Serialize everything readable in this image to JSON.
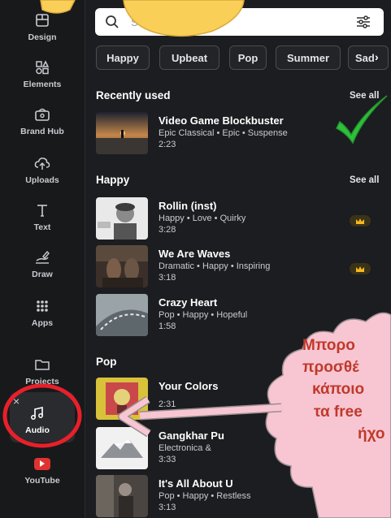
{
  "sidebar": {
    "items": [
      {
        "label": "Design",
        "icon": "layout-icon"
      },
      {
        "label": "Elements",
        "icon": "shapes-icon"
      },
      {
        "label": "Brand Hub",
        "icon": "brand-icon"
      },
      {
        "label": "Uploads",
        "icon": "cloud-upload-icon"
      },
      {
        "label": "Text",
        "icon": "text-icon"
      },
      {
        "label": "Draw",
        "icon": "draw-icon"
      },
      {
        "label": "Apps",
        "icon": "apps-grid-icon"
      },
      {
        "label": "Projects",
        "icon": "folder-icon"
      },
      {
        "label": "Audio",
        "icon": "music-note-icon"
      },
      {
        "label": "YouTube",
        "icon": "youtube-icon"
      }
    ],
    "close_label": "×"
  },
  "search": {
    "placeholder": "Se"
  },
  "chips": [
    "Happy",
    "Upbeat",
    "Pop",
    "Summer",
    "Sad"
  ],
  "sections": {
    "recent": {
      "title": "Recently used",
      "see_all": "See all"
    },
    "happy": {
      "title": "Happy",
      "see_all": "See all"
    },
    "pop": {
      "title": "Pop"
    }
  },
  "tracks": {
    "recent": [
      {
        "title": "Video Game Blockbuster",
        "tags": "Epic Classical • Epic • Suspense",
        "duration": "2:23"
      }
    ],
    "happy": [
      {
        "title": "Rollin (inst)",
        "tags": "Happy • Love • Quirky",
        "duration": "3:28",
        "pro": true
      },
      {
        "title": "We Are Waves",
        "tags": "Dramatic • Happy • Inspiring",
        "duration": "3:18",
        "pro": true
      },
      {
        "title": "Crazy Heart",
        "tags": "Pop • Happy • Hopeful",
        "duration": "1:58",
        "pro": false
      }
    ],
    "pop": [
      {
        "title": "Your Colors",
        "tags": "",
        "duration": "2:31"
      },
      {
        "title": "Gangkhar Pu",
        "tags": "Electronica &",
        "duration": "3:33"
      },
      {
        "title": "It's All About U",
        "tags": "Pop • Happy • Restless",
        "duration": "3:13"
      }
    ]
  },
  "annotation": {
    "cloud_lines": [
      "Μπορο",
      "προσθέ",
      "κάποιο",
      "τα free",
      "ήχο"
    ],
    "colors": {
      "cloud": "#f7c6d2",
      "cloud_text": "#c0392b",
      "circle": "#e8202a",
      "check": "#2ec13b",
      "sticker": "#f9cf58"
    }
  }
}
